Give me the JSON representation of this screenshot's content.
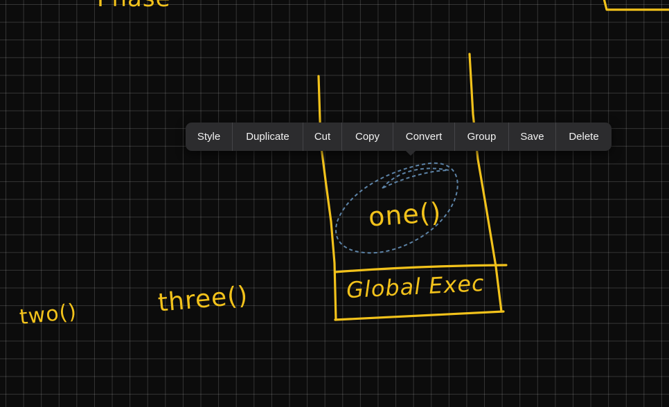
{
  "canvas": {
    "ink_color": "#f2c21b",
    "selection_color": "#5d84a8",
    "top_partial_text": "Phase",
    "stack_frame_label": "one()",
    "stack_base_label": "Global Exec",
    "loose_label_three": "three()",
    "loose_label_two": "two()"
  },
  "context_menu": {
    "items": [
      "Style",
      "Duplicate",
      "Cut",
      "Copy",
      "Convert",
      "Group",
      "Save",
      "Delete"
    ]
  }
}
